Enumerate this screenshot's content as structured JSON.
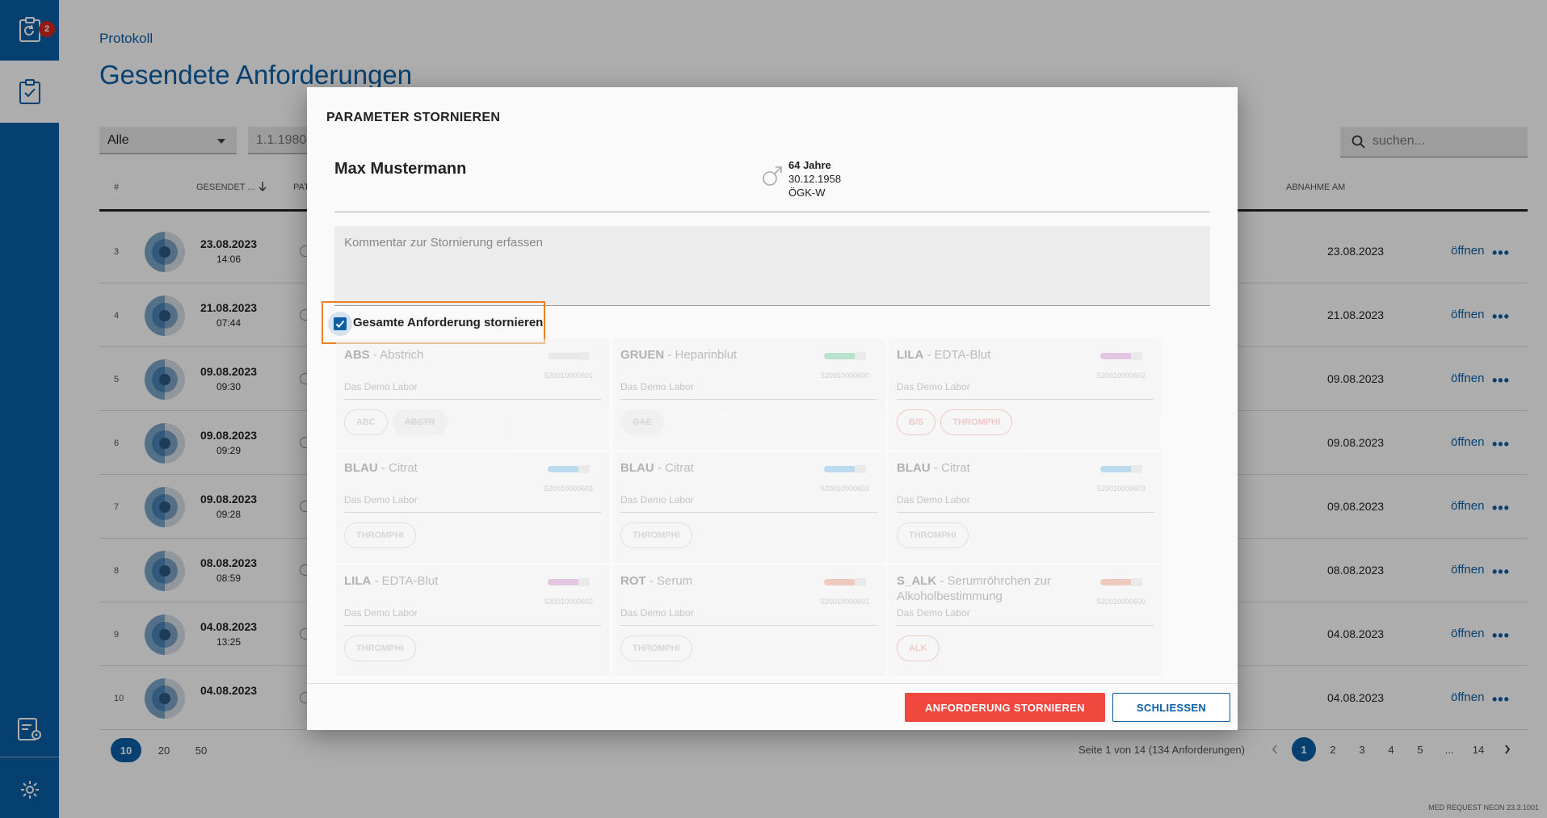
{
  "sidebar": {
    "badge_count": "2",
    "items": [
      "clipboard-refresh",
      "clipboard-check",
      "clipboard-settings",
      "settings"
    ]
  },
  "page": {
    "breadcrumb": "Protokoll",
    "title": "Gesendete Anforderungen",
    "filter_value": "Alle",
    "date_value": "1.1.1980",
    "search_placeholder": "suchen..."
  },
  "table": {
    "headers": {
      "num": "#",
      "sent": "GESENDET ...",
      "patient": "PAT",
      "abnahme": "ABNAHME AM"
    },
    "rows": [
      {
        "num": "3",
        "date": "23.08.2023",
        "time": "14:06",
        "abnahme": "23.08.2023",
        "open": "öffnen"
      },
      {
        "num": "4",
        "date": "21.08.2023",
        "time": "07:44",
        "abnahme": "21.08.2023",
        "open": "öffnen"
      },
      {
        "num": "5",
        "date": "09.08.2023",
        "time": "09:30",
        "abnahme": "09.08.2023",
        "open": "öffnen"
      },
      {
        "num": "6",
        "date": "09.08.2023",
        "time": "09:29",
        "abnahme": "09.08.2023",
        "open": "öffnen"
      },
      {
        "num": "7",
        "date": "09.08.2023",
        "time": "09:28",
        "abnahme": "09.08.2023",
        "open": "öffnen"
      },
      {
        "num": "8",
        "date": "08.08.2023",
        "time": "08:59",
        "abnahme": "08.08.2023",
        "open": "öffnen"
      },
      {
        "num": "9",
        "date": "04.08.2023",
        "time": "13:25",
        "abnahme": "04.08.2023",
        "open": "öffnen"
      },
      {
        "num": "10",
        "date": "04.08.2023",
        "time": "",
        "abnahme": "04.08.2023",
        "open": "öffnen"
      }
    ]
  },
  "pager": {
    "sizes": [
      "10",
      "20",
      "50"
    ],
    "info": "Seite 1 von 14 (134 Anforderungen)",
    "pages": [
      "1",
      "2",
      "3",
      "4",
      "5",
      "...",
      "14"
    ]
  },
  "version": "MED REQUEST NEON 23.3.1001",
  "modal": {
    "title": "PARAMETER STORNIEREN",
    "patient_name": "Max Mustermann",
    "age": "64 Jahre",
    "birthdate": "30.12.1958",
    "insurance": "ÖGK-W",
    "comment_placeholder": "Kommentar zur Stornierung erfassen",
    "checkbox_label": "Gesamte Anforderung stornieren",
    "cards": [
      {
        "code": "ABS",
        "desc": " - Abstrich",
        "lab": "Das Demo Labor",
        "tube_id": "520010000601",
        "tube": "#cccccc",
        "chips": [
          "ABC",
          "ABSTR"
        ]
      },
      {
        "code": "GRUEN",
        "desc": " - Heparinblut",
        "lab": "Das Demo Labor",
        "tube_id": "520010000600",
        "tube": "#3bb37a",
        "chips": [
          "GAE"
        ]
      },
      {
        "code": "LILA",
        "desc": " - EDTA-Blut",
        "lab": "Das Demo Labor",
        "tube_id": "520010000602",
        "tube": "#b660b6",
        "chips": [
          "B/S",
          "THROMPHI"
        ]
      },
      {
        "code": "BLAU",
        "desc": " - Citrat",
        "lab": "Das Demo Labor",
        "tube_id": "520010000603",
        "tube": "#3aa0d8",
        "chips": [
          "THROMPHI"
        ]
      },
      {
        "code": "BLAU",
        "desc": " - Citrat",
        "lab": "Das Demo Labor",
        "tube_id": "520010000603",
        "tube": "#3aa0d8",
        "chips": [
          "THROMPHI"
        ]
      },
      {
        "code": "BLAU",
        "desc": " - Citrat",
        "lab": "Das Demo Labor",
        "tube_id": "520010000603",
        "tube": "#3aa0d8",
        "chips": [
          "THROMPHI"
        ]
      },
      {
        "code": "LILA",
        "desc": " - EDTA-Blut",
        "lab": "Das Demo Labor",
        "tube_id": "520010000602",
        "tube": "#b660b6",
        "chips": [
          "THROMPHI"
        ]
      },
      {
        "code": "ROT",
        "desc": " - Serum",
        "lab": "Das Demo Labor",
        "tube_id": "520010000601",
        "tube": "#e06a4a",
        "chips": [
          "THROMPHI"
        ]
      },
      {
        "code": "S_ALK",
        "desc": " - Serumröhrchen zur Alkoholbestimmung",
        "lab": "Das Demo Labor",
        "tube_id": "520010000600",
        "tube": "#e06a4a",
        "chips": [
          "ALK"
        ]
      }
    ],
    "btn_cancel_request": "ANFORDERUNG STORNIEREN",
    "btn_close": "SCHLIESSEN"
  },
  "colors": {
    "brand": "#0a5fa6",
    "danger": "#f0483e",
    "highlight": "#e8822a"
  }
}
